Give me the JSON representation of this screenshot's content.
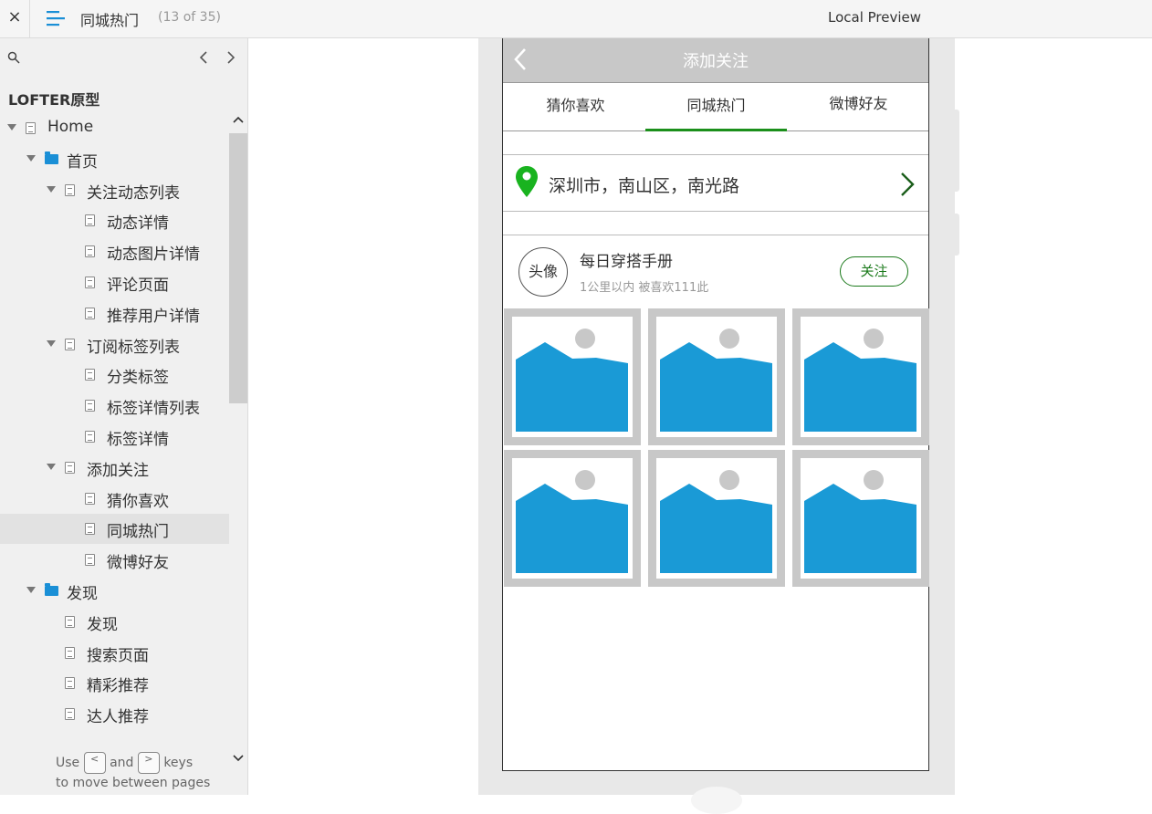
{
  "topbar": {
    "close_label": "×",
    "page_title": "同城热门",
    "page_count": "(13 of 35)",
    "preview_label": "Local Preview"
  },
  "sidebar": {
    "project_title": "LOFTER原型",
    "tree": [
      {
        "label": "Home",
        "type": "page",
        "level": 0,
        "expanded": true
      },
      {
        "label": "首页",
        "type": "folder",
        "level": 1,
        "expanded": true
      },
      {
        "label": "关注动态列表",
        "type": "page",
        "level": 2,
        "expanded": true
      },
      {
        "label": "动态详情",
        "type": "page",
        "level": 3
      },
      {
        "label": "动态图片详情",
        "type": "page",
        "level": 3
      },
      {
        "label": "评论页面",
        "type": "page",
        "level": 3
      },
      {
        "label": "推荐用户详情",
        "type": "page",
        "level": 3
      },
      {
        "label": "订阅标签列表",
        "type": "page",
        "level": 2,
        "expanded": true
      },
      {
        "label": "分类标签",
        "type": "page",
        "level": 3
      },
      {
        "label": "标签详情列表",
        "type": "page",
        "level": 3
      },
      {
        "label": "标签详情",
        "type": "page",
        "level": 3
      },
      {
        "label": "添加关注",
        "type": "page",
        "level": 2,
        "expanded": true
      },
      {
        "label": "猜你喜欢",
        "type": "page",
        "level": 3
      },
      {
        "label": "同城热门",
        "type": "page",
        "level": 3,
        "selected": true
      },
      {
        "label": "微博好友",
        "type": "page",
        "level": 3
      },
      {
        "label": "发现",
        "type": "folder",
        "level": 1,
        "expanded": true
      },
      {
        "label": "发现",
        "type": "page",
        "level": 2
      },
      {
        "label": "搜索页面",
        "type": "page",
        "level": 2
      },
      {
        "label": "精彩推荐",
        "type": "page",
        "level": 2
      },
      {
        "label": "达人推荐",
        "type": "page",
        "level": 2
      }
    ],
    "hint": {
      "use": "Use",
      "key_prev": "<",
      "and": "and",
      "key_next": ">",
      "keys": "keys",
      "line2": "to move between pages"
    }
  },
  "app": {
    "title": "添加关注",
    "tabs": [
      "猜你喜欢",
      "同城热门",
      "微博好友"
    ],
    "active_tab": 1,
    "location": "深圳市，南山区，南光路",
    "user": {
      "avatar_label": "头像",
      "name": "每日穿搭手册",
      "meta": "1公里以内 被喜欢111此",
      "follow_label": "关注"
    },
    "image_count": 6,
    "colors": {
      "accent_green": "#1b8f1b",
      "pin_green": "#19b31f",
      "image_blue": "#1a9ad6",
      "header_gray": "#c8c8c8"
    }
  }
}
